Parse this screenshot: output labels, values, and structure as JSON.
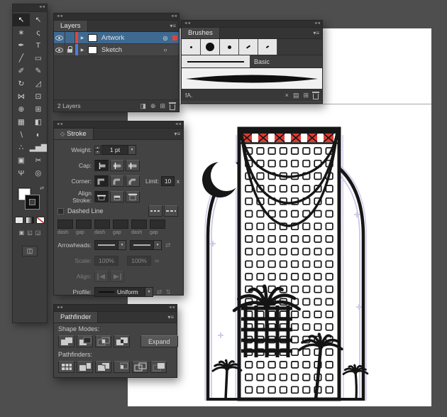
{
  "colors": {
    "selection_blue": "#3e6a92",
    "artwork_layer_color": "#e2453c",
    "sketch_layer_color": "#4e7fd6",
    "ornament_red": "#df3b31",
    "sketch_line": "#cdc7ea"
  },
  "icons": {
    "collapse": "◄◄",
    "panel_menu": "▾≡",
    "layer_expand": "▶",
    "target_circle": "○",
    "target_circle_selected": "◎",
    "clipping_mask": "◨",
    "new_sublayer": "⊕",
    "new_layer": "⊞",
    "swap_fill_stroke": "⇄",
    "dropdown_arrow": "▾",
    "stepper_up": "▴",
    "stepper_down": "▾",
    "arrowhead_swap": "⇄",
    "scale_link": "∞",
    "profile_flip_across": "⇄",
    "profile_flip_along": "⇅",
    "remove_brush": "×",
    "brush_options": "▤",
    "new_brush": "⊞",
    "brush_library": "fA.",
    "stroke_panel_glyph": "◇",
    "screen_mode": "◫",
    "draw_normal": "▣",
    "draw_behind": "◱",
    "draw_inside": "◲"
  },
  "toolbar": {
    "tools": [
      {
        "name": "selection-tool",
        "glyph": "↖",
        "active": true
      },
      {
        "name": "direct-selection-tool",
        "glyph": "↖"
      },
      {
        "name": "magic-wand-tool",
        "glyph": "∗"
      },
      {
        "name": "lasso-tool",
        "glyph": "ς"
      },
      {
        "name": "pen-tool",
        "glyph": "✒"
      },
      {
        "name": "type-tool",
        "glyph": "T"
      },
      {
        "name": "line-segment-tool",
        "glyph": "╱"
      },
      {
        "name": "rectangle-tool",
        "glyph": "▭"
      },
      {
        "name": "paintbrush-tool",
        "glyph": "✐"
      },
      {
        "name": "pencil-tool",
        "glyph": "✎"
      },
      {
        "name": "rotate-tool",
        "glyph": "↻"
      },
      {
        "name": "scale-tool",
        "glyph": "◿"
      },
      {
        "name": "width-tool",
        "glyph": "⋈"
      },
      {
        "name": "free-transform-tool",
        "glyph": "⊡"
      },
      {
        "name": "shape-builder-tool",
        "glyph": "⊕"
      },
      {
        "name": "perspective-grid-tool",
        "glyph": "⊞"
      },
      {
        "name": "mesh-tool",
        "glyph": "▦"
      },
      {
        "name": "gradient-tool",
        "glyph": "◧"
      },
      {
        "name": "eyedropper-tool",
        "glyph": "∖"
      },
      {
        "name": "blend-tool",
        "glyph": "◐"
      },
      {
        "name": "symbol-sprayer-tool",
        "glyph": "∴"
      },
      {
        "name": "column-graph-tool",
        "glyph": "▂▅▇"
      },
      {
        "name": "artboard-tool",
        "glyph": "▣"
      },
      {
        "name": "slice-tool",
        "glyph": "✂"
      },
      {
        "name": "hand-tool",
        "glyph": "Ψ"
      },
      {
        "name": "zoom-tool",
        "glyph": "◎"
      }
    ]
  },
  "layers_panel": {
    "tab": "Layers",
    "layers": [
      {
        "name": "Artwork",
        "selected": true,
        "locked": false
      },
      {
        "name": "Sketch",
        "selected": false,
        "locked": true
      }
    ],
    "status": "2 Layers"
  },
  "brushes_panel": {
    "tab": "Brushes",
    "brush_name": "Basic"
  },
  "stroke_panel": {
    "tab": "Stroke",
    "weight_label": "Weight:",
    "weight_value": "1 pt",
    "cap_label": "Cap:",
    "corner_label": "Corner:",
    "limit_label": "Limit:",
    "limit_value": "10",
    "limit_suffix": "x",
    "align_stroke_label": "Align Stroke:",
    "dashed_line_label": "Dashed Line",
    "dash_gap_labels": [
      "dash",
      "gap",
      "dash",
      "gap",
      "dash",
      "gap"
    ],
    "arrowheads_label": "Arrowheads:",
    "scale_label": "Scale:",
    "scale_values": [
      "100%",
      "100%"
    ],
    "align_label": "Align:",
    "profile_label": "Profile:",
    "profile_value": "Uniform"
  },
  "pathfinder_panel": {
    "tab": "Pathfinder",
    "shape_modes_label": "Shape Modes:",
    "expand_button": "Expand",
    "pathfinders_label": "Pathfinders:"
  }
}
